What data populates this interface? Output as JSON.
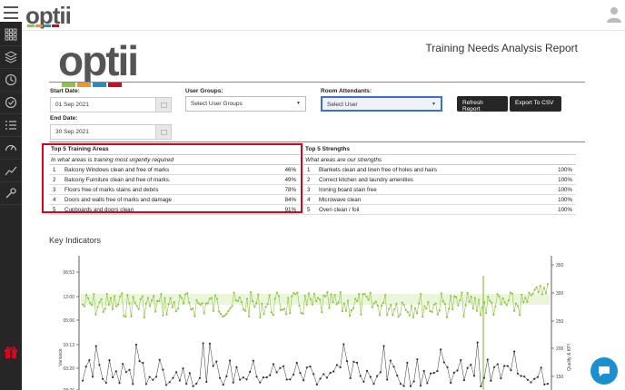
{
  "app": {
    "logo": "optii"
  },
  "report": {
    "title": "Training Needs Analysis Report"
  },
  "filters": {
    "start_date_label": "Start Date:",
    "start_date": "01 Sep 2021",
    "end_date_label": "End Date:",
    "end_date": "30 Sep 2021",
    "user_groups_label": "User Groups:",
    "user_groups_value": "Select User Groups",
    "room_attendants_label": "Room Attendants:",
    "room_attendants_value": "Select User",
    "refresh_label": "Refresh Report",
    "export_label": "Export To CSV"
  },
  "training": {
    "title": "Top 5 Training Areas",
    "subtitle": "In what areas is training most urgently required",
    "rows": [
      {
        "n": "1",
        "desc": "Balcony Windows clean and free of marks",
        "pct": "46%"
      },
      {
        "n": "2",
        "desc": "Balcony Furniture clean and free of marks.",
        "pct": "49%"
      },
      {
        "n": "3",
        "desc": "Floors free of marks stains and debris",
        "pct": "78%"
      },
      {
        "n": "4",
        "desc": "Doors and walls free of marks and damage",
        "pct": "84%"
      },
      {
        "n": "5",
        "desc": "Cupboards and doors clean",
        "pct": "91%"
      }
    ]
  },
  "strengths": {
    "title": "Top 5 Strengths",
    "subtitle": "What areas are our strengths",
    "rows": [
      {
        "n": "1",
        "desc": "Blankets clean and linen free of holes and hairs",
        "pct": "100%"
      },
      {
        "n": "2",
        "desc": "Correct kitchen and laundry amenities",
        "pct": "100%"
      },
      {
        "n": "3",
        "desc": "Ironing board stain free",
        "pct": "100%"
      },
      {
        "n": "4",
        "desc": "Microwave clean",
        "pct": "100%"
      },
      {
        "n": "5",
        "desc": "Oven clean / foil",
        "pct": "100%"
      }
    ]
  },
  "key_indicators": {
    "title": "Key Indicators"
  },
  "chart_data": {
    "type": "line",
    "left_axis": {
      "label": "Variance",
      "ticks": [
        "06:53",
        "12:00",
        "05:06",
        "10:13",
        "03:20",
        "08:26"
      ]
    },
    "right_axis": {
      "label": "Quality & KPI",
      "ticks": [
        "350",
        "300",
        "250",
        "200",
        "150"
      ]
    },
    "series": [
      {
        "color": "#8dc63f"
      },
      {
        "color": "#333333"
      }
    ]
  },
  "colors": {
    "accent": "#e0001b",
    "brand_green": "#8dc63f",
    "sidebar": "#262626",
    "chat": "#1a8fd2"
  }
}
